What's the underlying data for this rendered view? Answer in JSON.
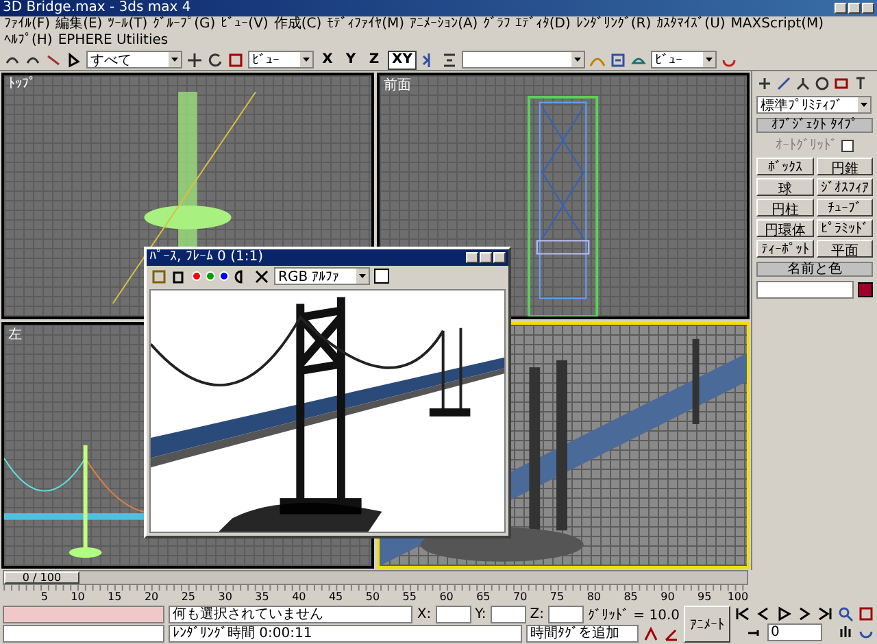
{
  "window": {
    "title": "3D Bridge.max - 3ds max 4"
  },
  "menu": [
    "ﾌｧｲﾙ(F)",
    "編集(E)",
    "ﾂｰﾙ(T)",
    "ｸﾞﾙｰﾌﾟ(G)",
    "ﾋﾞｭｰ(V)",
    "作成(C)",
    "ﾓﾃﾞｨﾌｧｲﾔ(M)",
    "ｱﾆﾒｰｼｮﾝ(A)",
    "ｸﾞﾗﾌ ｴﾃﾞｨﾀ(D)",
    "ﾚﾝﾀﾞﾘﾝｸﾞ(R)",
    "ｶｽﾀﾏｲｽﾞ(U)",
    "MAXScript(M)",
    "ﾍﾙﾌﾟ(H)",
    "EPHERE Utilities"
  ],
  "toolbar": {
    "selection_filter": "すべて",
    "reference_coord": "ﾋﾞｭｰ",
    "axis_buttons": [
      {
        "label": "X",
        "selected": false
      },
      {
        "label": "Y",
        "selected": false
      },
      {
        "label": "Z",
        "selected": false
      },
      {
        "label": "XY",
        "selected": true
      }
    ],
    "render_type": "ﾋﾞｭｰ"
  },
  "viewports": [
    {
      "label": "ﾄｯﾌﾟ",
      "kind": "top",
      "active": false
    },
    {
      "label": "前面",
      "kind": "front",
      "active": false
    },
    {
      "label": "左",
      "kind": "left",
      "active": false
    },
    {
      "kind": "perspective",
      "active": true
    }
  ],
  "frame_buffer": {
    "title": "ﾊﾟｰｽ, ﾌﾚｰﾑ 0 (1:1)",
    "channel": "RGB ｱﾙﾌｧ"
  },
  "command_panel": {
    "category": "標準ﾌﾟﾘﾐﾃｨﾌﾞ",
    "object_type": {
      "title": "ｵﾌﾞｼﾞｪｸﾄ ﾀｲﾌﾟ",
      "autogrid_label": "ｵｰﾄｸﾞﾘｯﾄﾞ",
      "autogrid_checked": false,
      "buttons": [
        "ﾎﾞｯｸｽ",
        "円錐",
        "球",
        "ｼﾞｵｽﾌｨｱ",
        "円柱",
        "ﾁｭｰﾌﾞ",
        "円環体",
        "ﾋﾟﾗﾐｯﾄﾞ",
        "ﾃｨｰﾎﾟｯﾄ",
        "平面"
      ]
    },
    "name_color": {
      "title": "名前と色",
      "color": "#a0002a"
    }
  },
  "time_slider": {
    "label": "0 / 100",
    "level": 0
  },
  "ruler_ticks": [
    "5",
    "10",
    "15",
    "20",
    "25",
    "30",
    "35",
    "40",
    "45",
    "50",
    "55",
    "60",
    "65",
    "70",
    "75",
    "80",
    "85",
    "90",
    "95",
    "100"
  ],
  "status": {
    "prompt": "何も選択されていません",
    "render_time": "ﾚﾝﾀﾞﾘﾝｸﾞ時間  0:00:11",
    "x_label": "X:",
    "y_label": "Y:",
    "z_label": "Z:",
    "grid": "ｸﾞﾘｯﾄﾞ = 10.0",
    "time_tag": "時間ﾀｸﾞを追加",
    "animate": "ｱﾆﾒｰﾄ",
    "animate_on": false,
    "frame": "0"
  }
}
